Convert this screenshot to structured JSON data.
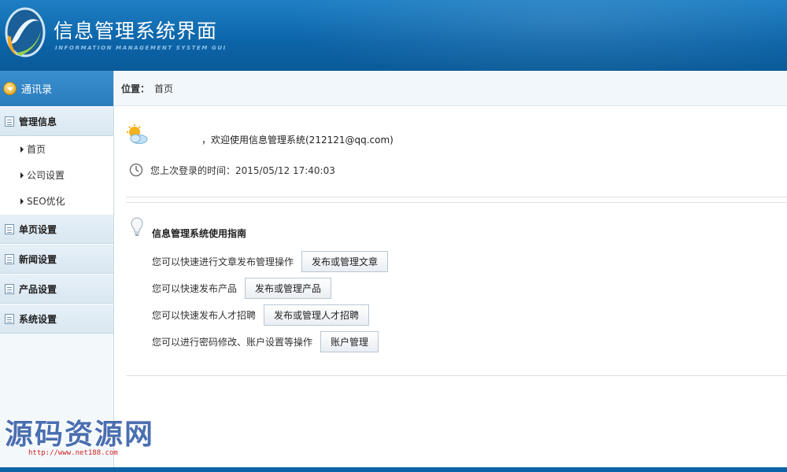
{
  "header": {
    "title": "信息管理系统界面",
    "subtitle": "INFORMATION MANAGEMENT SYSTEM GUI"
  },
  "sidebar": {
    "top_label": "通讯录",
    "groups": [
      {
        "label": "管理信息",
        "items": [
          "首页",
          "公司设置",
          "SEO优化"
        ]
      },
      {
        "label": "单页设置"
      },
      {
        "label": "新闻设置"
      },
      {
        "label": "产品设置"
      },
      {
        "label": "系统设置"
      }
    ]
  },
  "breadcrumb": {
    "label": "位置：",
    "current": "首页"
  },
  "welcome": {
    "text": "，欢迎使用信息管理系统(212121@qq.com)",
    "last_login": "您上次登录的时间：2015/05/12 17:40:03"
  },
  "guide": {
    "title": "信息管理系统使用指南",
    "rows": [
      {
        "text": "您可以快速进行文章发布管理操作",
        "button": "发布或管理文章"
      },
      {
        "text": "您可以快速发布产品",
        "button": "发布或管理产品"
      },
      {
        "text": "您可以快速发布人才招聘",
        "button": "发布或管理人才招聘"
      },
      {
        "text": "您可以进行密码修改、账户设置等操作",
        "button": "账户管理"
      }
    ]
  },
  "watermark": {
    "text": "源码资源网",
    "url": "http://www.net188.com"
  },
  "colors": {
    "header_blue": "#0c64a8",
    "sidebar_bg": "#f3f8fb",
    "watermark_blue": "#4a6fb0",
    "watermark_red": "#d02020"
  }
}
